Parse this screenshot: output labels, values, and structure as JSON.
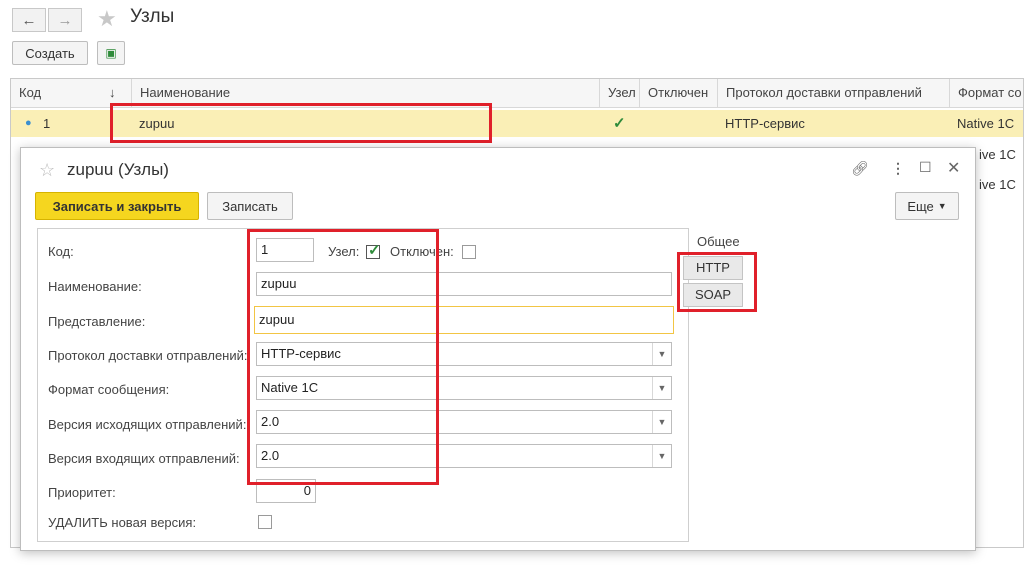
{
  "window": {
    "title": "Узлы"
  },
  "toolbar": {
    "create_label": "Создать"
  },
  "table": {
    "columns": [
      "Код",
      "↓",
      "Наименование",
      "Узел",
      "Отключен",
      "Протокол доставки отправлений",
      "Формат со"
    ],
    "rows": [
      {
        "code": "1",
        "name": "zupuu",
        "node": "✓",
        "disabled": "",
        "protocol": "HTTP-сервис",
        "format": "Native 1C"
      },
      {
        "code": "",
        "name": "",
        "node": "",
        "disabled": "",
        "protocol": "",
        "format": "ive 1C"
      },
      {
        "code": "",
        "name": "",
        "node": "",
        "disabled": "",
        "protocol": "",
        "format": "ive 1C"
      }
    ]
  },
  "dialog": {
    "title": "zupuu (Узлы)",
    "save_close_label": "Записать и закрыть",
    "save_label": "Записать",
    "more_label": "Еще",
    "fields": {
      "code_label": "Код:",
      "code_value": "1",
      "node_label": "Узел:",
      "disabled_label": "Отключен:",
      "name_label": "Наименование:",
      "name_value": "zupuu",
      "repr_label": "Представление:",
      "repr_value": "zupuu",
      "protocol_label": "Протокол доставки отправлений:",
      "protocol_value": "HTTP-сервис",
      "format_label": "Формат сообщения:",
      "format_value": "Native 1C",
      "out_version_label": "Версия исходящих отправлений:",
      "out_version_value": "2.0",
      "in_version_label": "Версия входящих отправлений:",
      "in_version_value": "2.0",
      "priority_label": "Приоритет:",
      "priority_value": "0",
      "delete_label": "УДАЛИТЬ новая версия:"
    },
    "side": {
      "header": "Общее",
      "http_label": "HTTP",
      "soap_label": "SOAP"
    }
  }
}
